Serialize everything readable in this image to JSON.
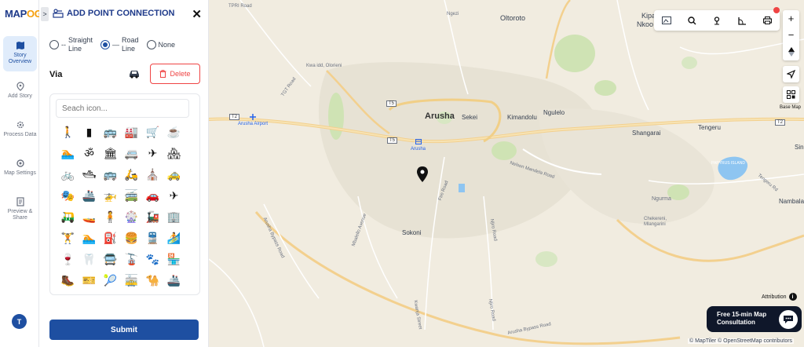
{
  "logo": {
    "text_main": "MAP",
    "text_accent": "OG"
  },
  "rail": {
    "items": [
      {
        "label": "Story Overview",
        "icon": "map-icon",
        "active": true
      },
      {
        "label": "Add Story",
        "icon": "pin-icon",
        "active": false
      },
      {
        "label": "Process Data",
        "icon": "gear-icon",
        "active": false
      },
      {
        "label": "Map Settings",
        "icon": "settings-icon",
        "active": false
      },
      {
        "label": "Preview & Share",
        "icon": "document-icon",
        "active": false
      }
    ],
    "avatar": "T"
  },
  "panel": {
    "collapse_glyph": ">",
    "title": "ADD POINT CONNECTION",
    "close_glyph": "✕",
    "connection_types": [
      {
        "label_line1": "Straight",
        "label_line2": "Line",
        "selected": false
      },
      {
        "label_line1": "Road",
        "label_line2": "Line",
        "selected": true
      },
      {
        "label_line1": "None",
        "label_line2": "",
        "selected": false
      }
    ],
    "via_label": "Via",
    "delete_label": "Delete",
    "search_placeholder": "Seach icon...",
    "icons": [
      "🚶",
      "▮",
      "🚌",
      "🏭",
      "🛒",
      "☕",
      "🏊",
      "ॐ",
      "🏛",
      "🚐",
      "✈",
      "🏘",
      "🚲",
      "🛥",
      "🚌",
      "🛵",
      "⛪",
      "🚕",
      "🎭",
      "🚢",
      "🚁",
      "🚎",
      "🚗",
      "✈",
      "🛺",
      "🚤",
      "🧍",
      "🎡",
      "🚂",
      "🏢",
      "🏋",
      "🏊",
      "⛽",
      "🍔",
      "🚆",
      "🏄",
      "🍷",
      "🦷",
      "🚍",
      "🚡",
      "🐾",
      "🏪",
      "🥾",
      "🎫",
      "🎾",
      "🚋",
      "🐪",
      "🚢"
    ],
    "submit_label": "Submit"
  },
  "map": {
    "labels": {
      "tpri": "TPRI Road",
      "ngezi": "Ngezi",
      "oltoroto": "Oltoroto",
      "kipa": "Kipa",
      "nkoo": "Nkoo",
      "kwa_idd": "Kwa idd, Olorieni",
      "tgt": "TGT Road",
      "arusha": "Arusha",
      "sekei": "Sekei",
      "kimandolu": "Kimandolu",
      "ngulelo": "Ngulelo",
      "shangarai": "Shangarai",
      "tengeru": "Tengeru",
      "arusha_airport": "Arusha Airport",
      "arusha_station": "Arusha",
      "nelson": "Nelson Mandela Road",
      "papyrus": "PAPYRUS ISLAND",
      "tengeru_rd": "Tengeru Rd",
      "fire_road": "Fire Road",
      "ngurma": "Ngurma",
      "nambala": "Nambala",
      "cheke": "Chekereni, Mlangarini",
      "sokoni": "Sokoni",
      "njiro": "Njiro Road",
      "arusha_bypass": "Arusha Bypass Road",
      "mbalello": "Mbalello Avenue",
      "kwanja": "Kwanja Street",
      "arusha_bypass2": "Arusha Bypass Road",
      "njiro2": "Njiro Road",
      "singa": "Sing",
      "t5a": "T5",
      "t5b": "T5",
      "t2a": "T2",
      "t2b": "T2"
    },
    "base_map_label": "Base Map",
    "attribution_label": "Attribution",
    "copyright": "© MapTiler © OpenStreetMap contributors",
    "consult": {
      "line1": "Free 15-min Map",
      "line2": "Consultation"
    },
    "zoom_in": "+",
    "zoom_out": "−"
  }
}
